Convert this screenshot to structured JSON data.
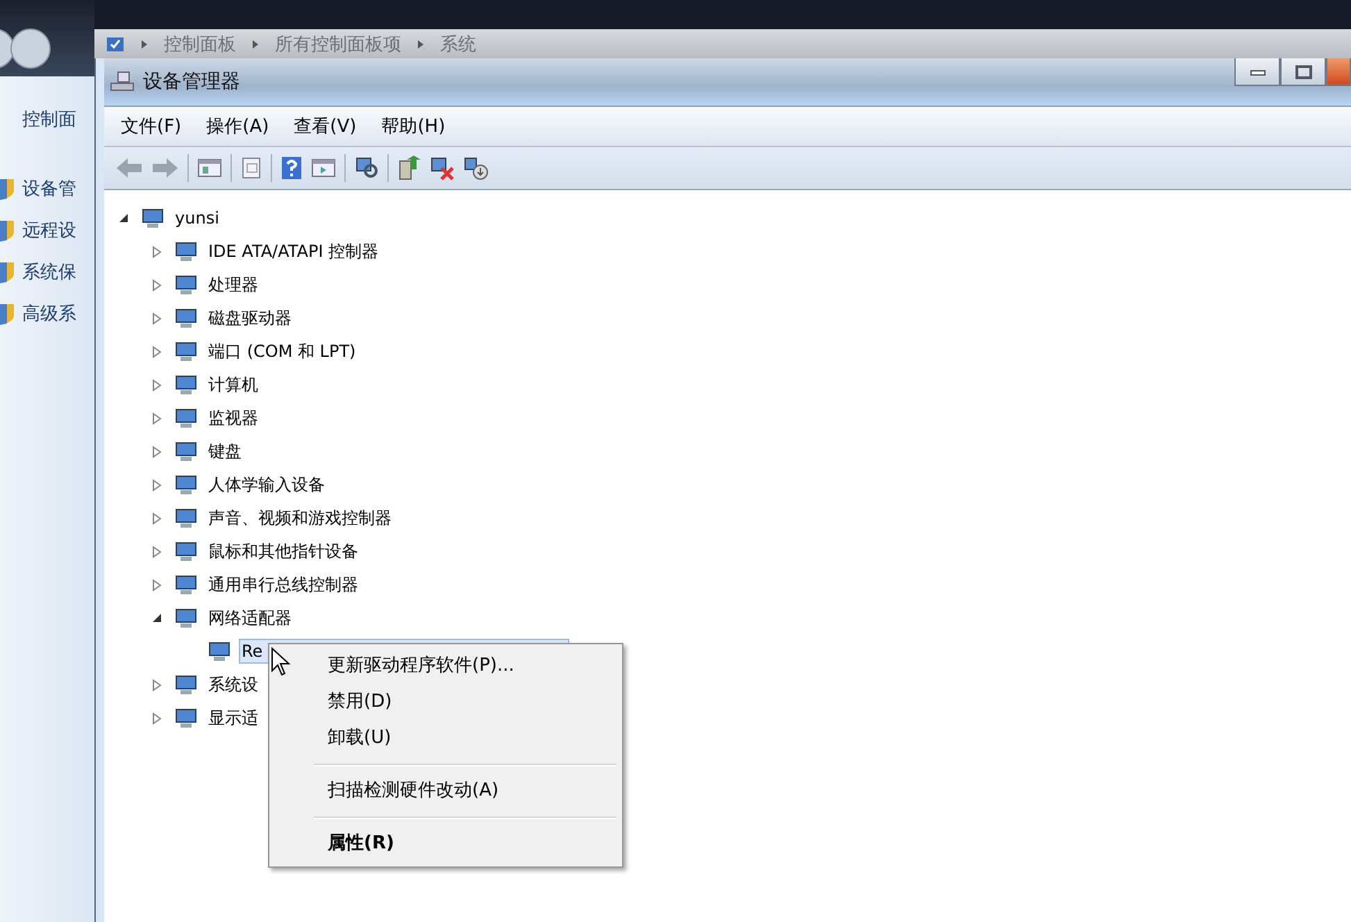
{
  "window_behind": {
    "breadcrumb": [
      "控制面板",
      "所有控制面板项",
      "系统"
    ]
  },
  "sidebar": {
    "heading": "控制面",
    "items": [
      "设备管",
      "远程设",
      "系统保",
      "高级系"
    ]
  },
  "window": {
    "title": "设备管理器"
  },
  "menu_bar": [
    "文件(F)",
    "操作(A)",
    "查看(V)",
    "帮助(H)"
  ],
  "tree": {
    "label": "yunsi",
    "expanded": true,
    "children": [
      {
        "label": "IDE ATA/ATAPI 控制器",
        "expanded": false
      },
      {
        "label": "处理器",
        "expanded": false
      },
      {
        "label": "磁盘驱动器",
        "expanded": false
      },
      {
        "label": "端口 (COM 和 LPT)",
        "expanded": false
      },
      {
        "label": "计算机",
        "expanded": false
      },
      {
        "label": "监视器",
        "expanded": false
      },
      {
        "label": "键盘",
        "expanded": false
      },
      {
        "label": "人体学输入设备",
        "expanded": false
      },
      {
        "label": "声音、视频和游戏控制器",
        "expanded": false
      },
      {
        "label": "鼠标和其他指针设备",
        "expanded": false
      },
      {
        "label": "通用串行总线控制器",
        "expanded": false
      },
      {
        "label": "网络适配器",
        "expanded": true,
        "children": [
          {
            "label": "Re",
            "selected": true
          }
        ]
      },
      {
        "label": "系统设",
        "expanded": false
      },
      {
        "label": "显示适",
        "expanded": false
      }
    ]
  },
  "context_menu": {
    "items": [
      {
        "kind": "item",
        "label": "更新驱动程序软件(P)...",
        "default": false
      },
      {
        "kind": "item",
        "label": "禁用(D)",
        "default": false
      },
      {
        "kind": "item",
        "label": "卸载(U)",
        "default": false
      },
      {
        "kind": "separator"
      },
      {
        "kind": "item",
        "label": "扫描检测硬件改动(A)",
        "default": false
      },
      {
        "kind": "separator"
      },
      {
        "kind": "item",
        "label": "属性(R)",
        "default": true
      }
    ]
  }
}
